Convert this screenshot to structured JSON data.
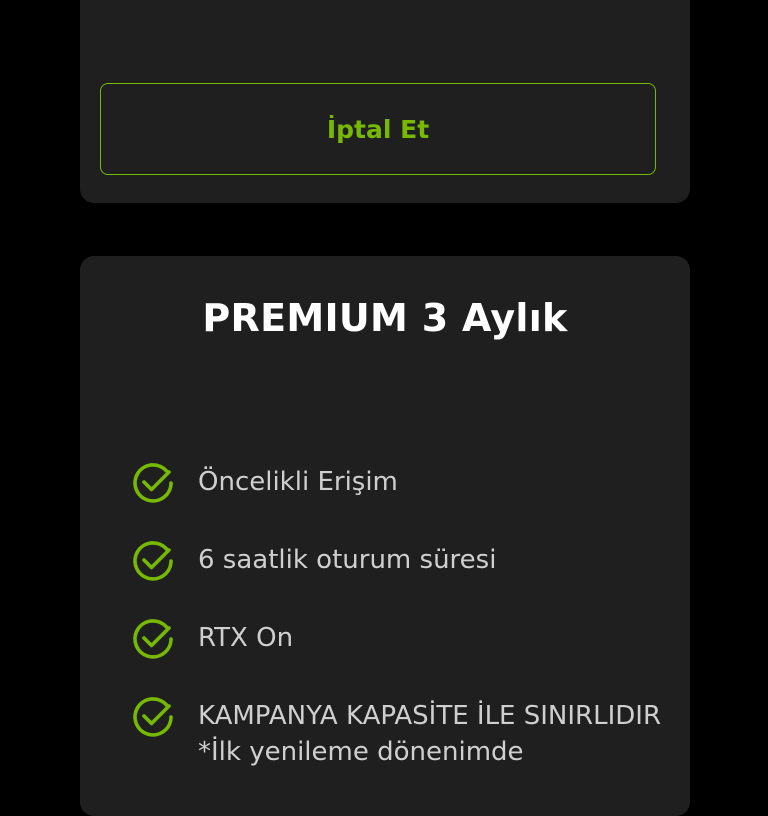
{
  "top_card": {
    "cancel_label": "İptal Et"
  },
  "plan_card": {
    "title": "PREMIUM 3 Aylık",
    "features": [
      {
        "text": "Öncelikli Erişim",
        "icon": "check-circle-icon"
      },
      {
        "text": "6 saatlik oturum süresi",
        "icon": "check-circle-icon"
      },
      {
        "text": "RTX On",
        "icon": "check-circle-icon"
      },
      {
        "text": "KAMPANYA KAPASİTE İLE SINIRLIDIR *İlk yenileme dönenimde",
        "icon": "check-circle-icon"
      }
    ]
  },
  "colors": {
    "accent": "#76b900",
    "card_bg": "#1f1f1f",
    "page_bg": "#000000",
    "title": "#ffffff",
    "feature_text": "#cfcfcf"
  }
}
